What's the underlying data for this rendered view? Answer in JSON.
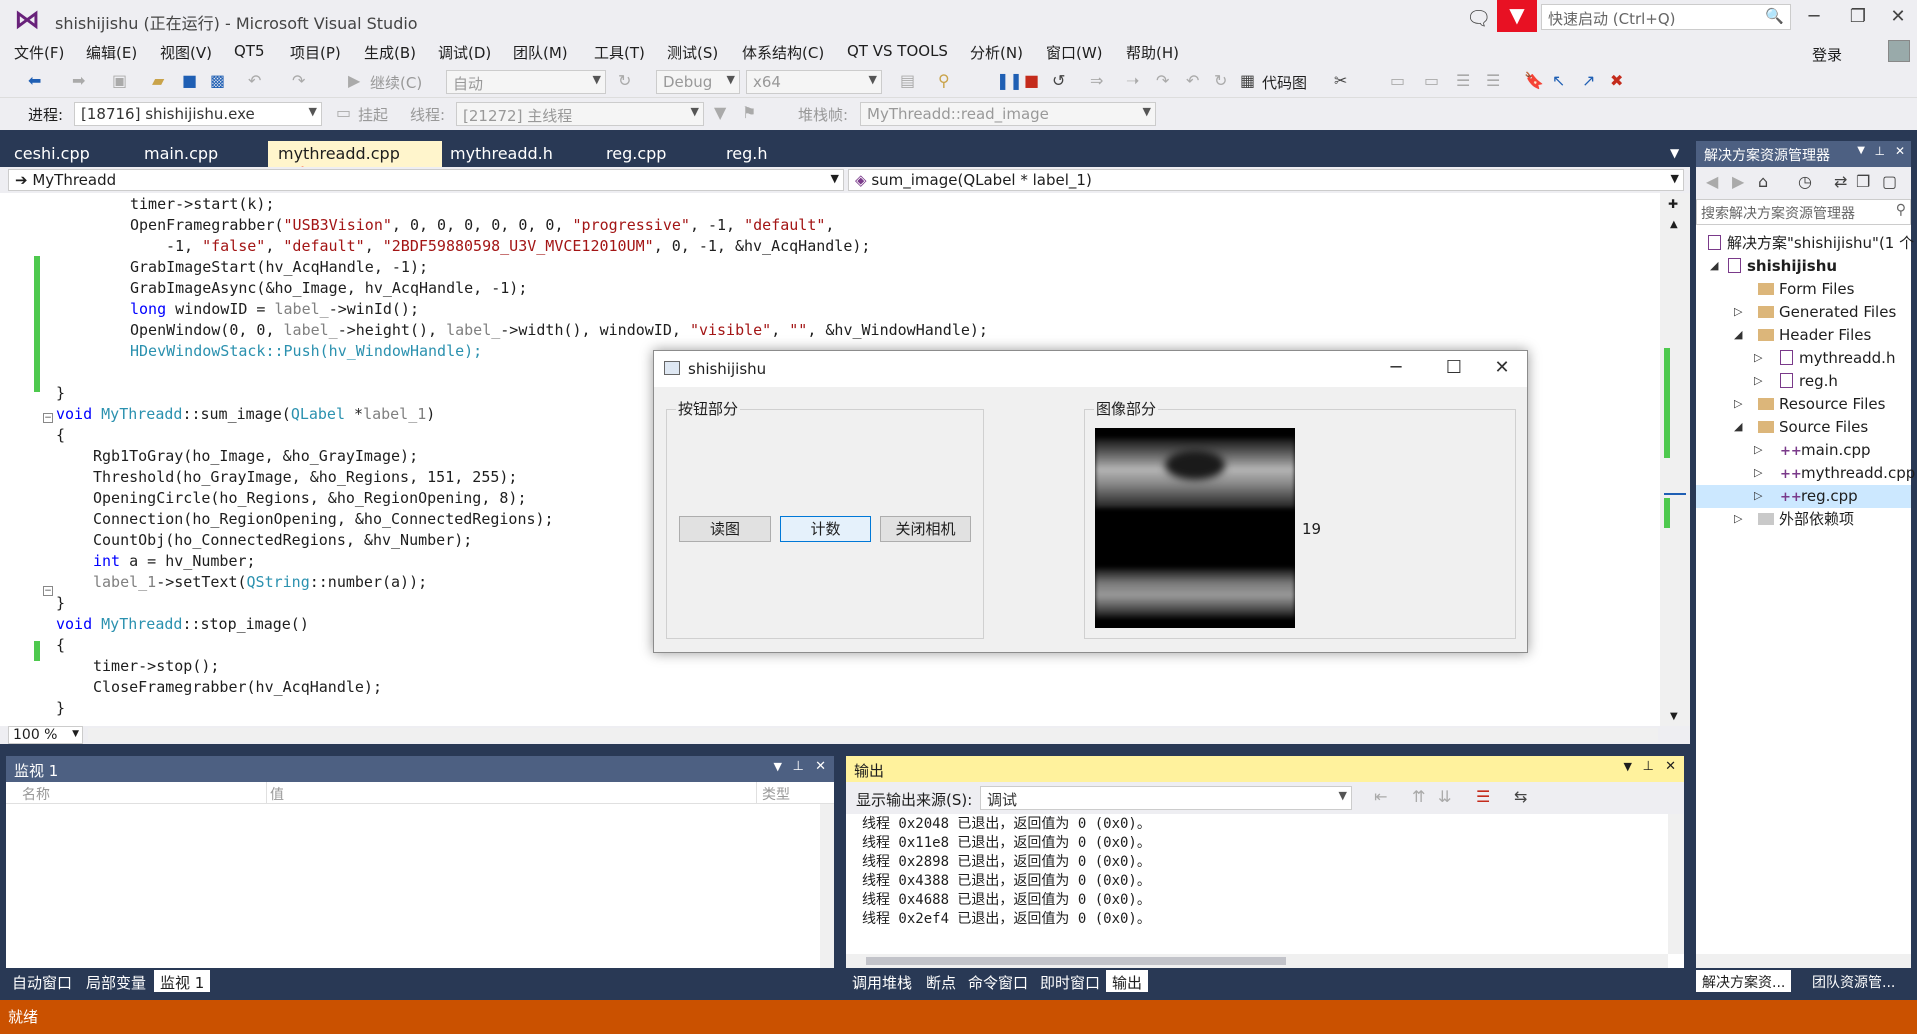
{
  "window": {
    "title": "shishijishu (正在运行) - Microsoft Visual Studio",
    "quick_launch_placeholder": "快速启动 (Ctrl+Q)",
    "login": "登录"
  },
  "menu": [
    "文件(F)",
    "编辑(E)",
    "视图(V)",
    "QT5",
    "项目(P)",
    "生成(B)",
    "调试(D)",
    "团队(M)",
    "工具(T)",
    "测试(S)",
    "体系结构(C)",
    "QT VS TOOLS",
    "分析(N)",
    "窗口(W)",
    "帮助(H)"
  ],
  "toolbar1": {
    "continue_label": "继续(C)",
    "auto_combo": "自动",
    "config_combo": "Debug",
    "platform_combo": "x64",
    "codemap_label": "代码图"
  },
  "toolbar2": {
    "process_label": "进程:",
    "process_value": "[18716] shishijishu.exe",
    "suspend_label": "挂起",
    "thread_label": "线程:",
    "thread_value": "[21272] 主线程",
    "stackframe_label": "堆栈帧:",
    "stackframe_value": "MyThreadd::read_image"
  },
  "doc_tabs": [
    "ceshi.cpp",
    "main.cpp",
    "mythreadd.cpp",
    "mythreadd.h",
    "reg.cpp",
    "reg.h"
  ],
  "nav": {
    "left": "MyThreadd",
    "right": "sum_image(QLabel * label_1)"
  },
  "code": [
    "timer->start(k);",
    "OpenFramegrabber(\"USB3Vision\", 0, 0, 0, 0, 0, 0, \"progressive\", -1, \"default\",",
    "-1, \"false\", \"default\", \"2BDF59880598_U3V_MVCE12010UM\", 0, -1, &hv_AcqHandle);",
    "GrabImageStart(hv_AcqHandle, -1);",
    "GrabImageAsync(&ho_Image, hv_AcqHandle, -1);",
    "long windowID = label_->winId();",
    "OpenWindow(0, 0, label_->height(), label_->width(), windowID, \"visible\", \"\", &hv_WindowHandle);",
    "HDevWindowStack::Push(hv_WindowHandle);",
    "",
    "}",
    "void MyThreadd::sum_image(QLabel *label_1)",
    "{",
    "Rgb1ToGray(ho_Image, &ho_GrayImage);",
    "Threshold(ho_GrayImage, &ho_Regions, 151, 255);",
    "OpeningCircle(ho_Regions, &ho_RegionOpening, 8);",
    "Connection(ho_RegionOpening, &ho_ConnectedRegions);",
    "CountObj(ho_ConnectedRegions, &hv_Number);",
    "int a = hv_Number;",
    "label_1->setText(QString::number(a));",
    "}",
    "void MyThreadd::stop_image()",
    "{",
    "timer->stop();",
    "CloseFramegrabber(hv_AcqHandle);",
    "}"
  ],
  "zoom": "100 %",
  "float_window": {
    "title": "shishijishu",
    "button_group_title": "按钮部分",
    "image_group_title": "图像部分",
    "buttons": [
      "读图",
      "计数",
      "关闭相机"
    ],
    "count_value": "19"
  },
  "watch_panel": {
    "title": "监视 1",
    "columns": [
      "名称",
      "值",
      "类型"
    ],
    "tabs": [
      "自动窗口",
      "局部变量",
      "监视 1"
    ]
  },
  "output_panel": {
    "title": "输出",
    "source_label": "显示输出来源(S):",
    "source_value": "调试",
    "lines": [
      "线程 0x2048 已退出，返回值为 0 (0x0)。",
      "线程 0x11e8 已退出，返回值为 0 (0x0)。",
      "线程 0x2898 已退出，返回值为 0 (0x0)。",
      "线程 0x4388 已退出，返回值为 0 (0x0)。",
      "线程 0x4688 已退出，返回值为 0 (0x0)。",
      "线程 0x2ef4 已退出，返回值为 0 (0x0)。"
    ],
    "tabs": [
      "调用堆栈",
      "断点",
      "命令窗口",
      "即时窗口",
      "输出"
    ]
  },
  "solution_explorer": {
    "title": "解决方案资源管理器",
    "search_placeholder": "搜索解决方案资源管理器",
    "solution": "解决方案\"shishijishu\"(1 个",
    "project": "shishijishu",
    "items": [
      "Form Files",
      "Generated Files",
      "Header Files",
      "mythreadd.h",
      "reg.h",
      "Resource Files",
      "Source Files",
      "main.cpp",
      "mythreadd.cpp",
      "reg.cpp",
      "外部依赖项"
    ],
    "tabs": [
      "解决方案资...",
      "团队资源管..."
    ]
  },
  "status": "就绪",
  "colors": {
    "accent": "#ca5100",
    "chrome": "#293955",
    "active_tab": "#fff5cc"
  }
}
